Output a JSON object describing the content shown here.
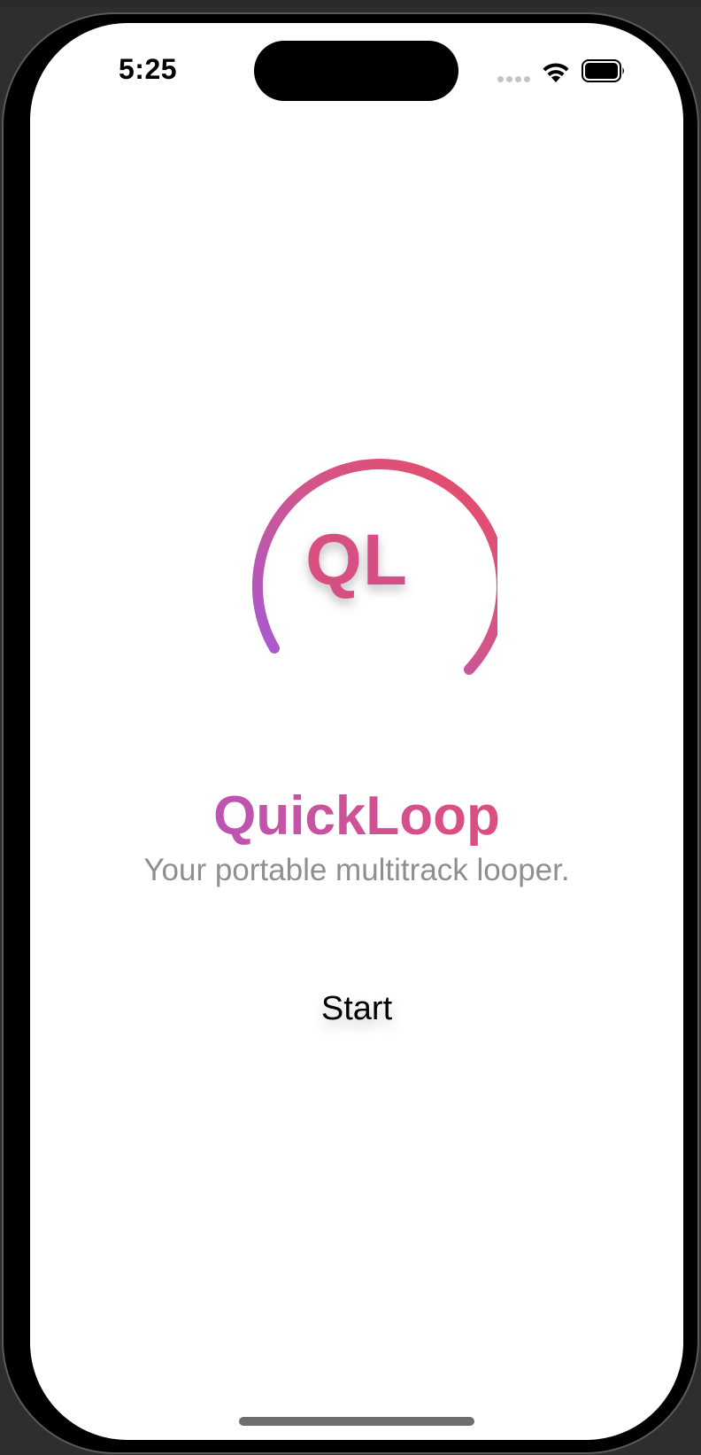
{
  "status_bar": {
    "time": "5:25",
    "icons": [
      "cellular-signal-icon",
      "wifi-icon",
      "battery-icon"
    ]
  },
  "logo": {
    "letters": "QL",
    "gradient_colors": [
      "#a35ad8",
      "#d6508a",
      "#ea4b62"
    ]
  },
  "app": {
    "title": "QuickLoop",
    "subtitle": "Your portable multitrack looper."
  },
  "actions": {
    "start_label": "Start"
  },
  "colors": {
    "subtitle_gray": "#8e8e93",
    "screen_background": "#ffffff",
    "accent_purple": "#a35ad8",
    "accent_pink": "#ea4b62"
  }
}
